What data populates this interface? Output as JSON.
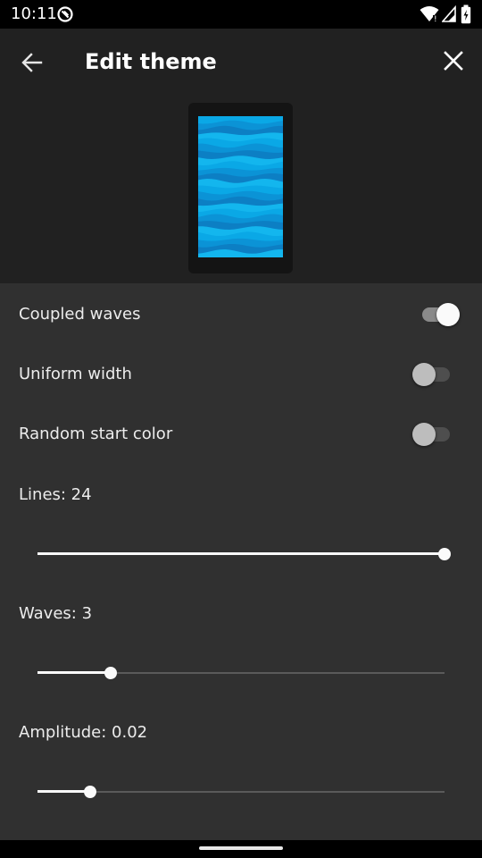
{
  "status_bar": {
    "time": "10:11",
    "icons": [
      "app-notification-icon",
      "wifi-icon",
      "signal-icon",
      "battery-icon"
    ]
  },
  "header": {
    "title": "Edit theme",
    "back_icon": "arrow-left-icon",
    "close_icon": "close-icon"
  },
  "preview": {
    "colors": [
      "#0aa8e6",
      "#0b93d6",
      "#0c7fc4",
      "#13b6ee"
    ]
  },
  "settings": {
    "coupled_waves": {
      "label": "Coupled waves",
      "on": true
    },
    "uniform_width": {
      "label": "Uniform width",
      "on": false
    },
    "random_start_color": {
      "label": "Random start color",
      "on": false
    },
    "lines": {
      "label": "Lines: 24",
      "fraction": 1.0
    },
    "waves": {
      "label": "Waves: 3",
      "fraction": 0.18
    },
    "amplitude": {
      "label": "Amplitude: 0.02",
      "fraction": 0.13
    }
  },
  "colors": {
    "background": "#303030",
    "header_background": "#212121",
    "accent": "#fafafa"
  }
}
